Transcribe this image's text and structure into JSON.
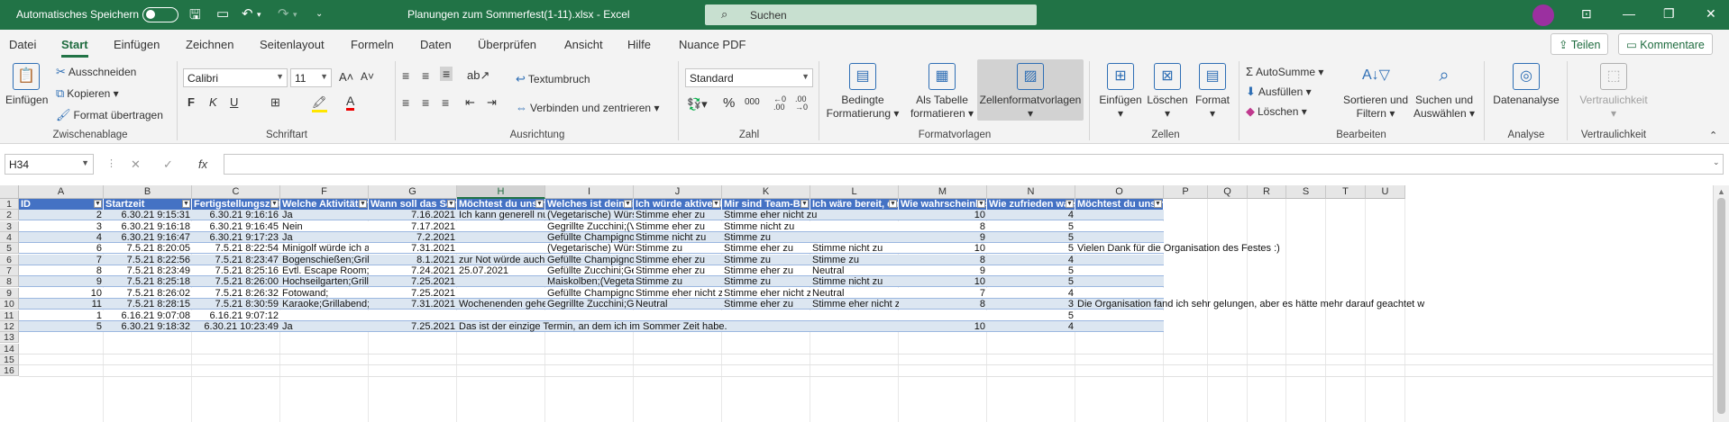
{
  "titlebar": {
    "autosave_label": "Automatisches Speichern",
    "doc_title": "Planungen zum Sommerfest(1-11).xlsx  -  Excel",
    "search_placeholder": "Suchen"
  },
  "tabs": [
    "Datei",
    "Start",
    "Einfügen",
    "Zeichnen",
    "Seitenlayout",
    "Formeln",
    "Daten",
    "Überprüfen",
    "Ansicht",
    "Hilfe",
    "Nuance PDF"
  ],
  "active_tab": "Start",
  "share_label": "Teilen",
  "comments_label": "Kommentare",
  "ribbon": {
    "clipboard": {
      "paste": "Einfügen",
      "cut": "Ausschneiden",
      "copy": "Kopieren",
      "format_painter": "Format übertragen",
      "group": "Zwischenablage"
    },
    "font": {
      "name": "Calibri",
      "size": "11",
      "bold": "F",
      "italic": "K",
      "underline": "U",
      "group": "Schriftart"
    },
    "alignment": {
      "wrap": "Textumbruch",
      "merge": "Verbinden und zentrieren",
      "group": "Ausrichtung"
    },
    "number": {
      "format": "Standard",
      "group": "Zahl"
    },
    "styles": {
      "conditional_1": "Bedingte",
      "conditional_2": "Formatierung",
      "table_1": "Als Tabelle",
      "table_2": "formatieren",
      "cell_styles": "Zellenformatvorlagen",
      "group": "Formatvorlagen"
    },
    "cells": {
      "insert": "Einfügen",
      "delete": "Löschen",
      "format": "Format",
      "group": "Zellen"
    },
    "editing": {
      "autosum": "AutoSumme",
      "fill": "Ausfüllen",
      "clear": "Löschen",
      "sort_1": "Sortieren und",
      "sort_2": "Filtern",
      "find_1": "Suchen und",
      "find_2": "Auswählen",
      "group": "Bearbeiten"
    },
    "analysis": {
      "label": "Datenanalyse",
      "group": "Analyse"
    },
    "sensitivity": {
      "label": "Vertraulichkeit",
      "group": "Vertraulichkeit"
    }
  },
  "formula_bar": {
    "name_box": "H34",
    "content": ""
  },
  "columns": [
    "A",
    "B",
    "C",
    "F",
    "G",
    "H",
    "I",
    "J",
    "K",
    "L",
    "M",
    "N",
    "O",
    "P",
    "Q",
    "R",
    "S",
    "T",
    "U"
  ],
  "selected_column": "H",
  "row_numbers": [
    "1",
    "2",
    "3",
    "4",
    "5",
    "6",
    "7",
    "8",
    "9",
    "10",
    "11",
    "12",
    "13",
    "14",
    "15",
    "16"
  ],
  "headers": [
    "ID",
    "Startzeit",
    "Fertigstellungszeit",
    "Welche Aktivitäten s",
    "Wann soll das Somm",
    "Möchtest du uns noc",
    "Welches ist dein lieb",
    "Ich würde aktive Unt",
    "Mir sind Team-Build",
    "Ich wäre bereit, eine",
    "Wie wahrscheinlich i",
    "Wie zufrieden warst",
    "Möchtest du uns noc"
  ],
  "rows": [
    [
      "2",
      "6.30.21 9:15:31",
      "6.30.21 9:16:16",
      "Ja",
      "7.16.2021",
      "Ich kann generell nur",
      "(Vegetarische) Würstc",
      "Stimme eher zu",
      "Stimme eher nicht zu",
      "",
      "10",
      "4",
      ""
    ],
    [
      "3",
      "6.30.21 9:16:18",
      "6.30.21 9:16:45",
      "Nein",
      "7.17.2021",
      "",
      "Gegrillte Zucchini;(Ve",
      "Stimme eher zu",
      "Stimme nicht zu",
      "",
      "8",
      "5",
      ""
    ],
    [
      "4",
      "6.30.21 9:16:47",
      "6.30.21 9:17:23",
      "Ja",
      "7.2.2021",
      "",
      "Gefüllte Champignon",
      "Stimme nicht zu",
      "Stimme zu",
      "",
      "9",
      "5",
      ""
    ],
    [
      "6",
      "7.5.21 8:20:05",
      "7.5.21 8:22:54",
      "Minigolf würde ich au",
      "7.31.2021",
      "",
      "(Vegetarische) Würstc",
      "Stimme zu",
      "Stimme eher zu",
      "Stimme nicht zu",
      "10",
      "5",
      "Vielen Dank für die Organisation des Festes :)"
    ],
    [
      "7",
      "7.5.21 8:22:56",
      "7.5.21 8:23:47",
      "Bogenschießen;Grilla",
      "8.1.2021",
      "zur Not würde auch 31",
      "Gefüllte Champignon",
      "Stimme eher zu",
      "Stimme zu",
      "Stimme zu",
      "8",
      "4",
      ""
    ],
    [
      "8",
      "7.5.21 8:23:49",
      "7.5.21 8:25:16",
      "Evtl. Escape Room;Kri",
      "7.24.2021",
      "25.07.2021",
      "Gefüllte Zucchini;Gef",
      "Stimme eher zu",
      "Stimme eher zu",
      "Neutral",
      "9",
      "5",
      ""
    ],
    [
      "9",
      "7.5.21 8:25:18",
      "7.5.21 8:26:00",
      "Hochseilgarten;Grilla",
      "7.25.2021",
      "",
      "Maiskolben;(Vegetari",
      "Stimme zu",
      "Stimme zu",
      "Stimme nicht zu",
      "10",
      "5",
      ""
    ],
    [
      "10",
      "7.5.21 8:26:02",
      "7.5.21 8:26:32",
      "Fotowand;",
      "7.25.2021",
      "",
      "Gefüllte Champignon",
      "Stimme eher nicht zu",
      "Stimme eher nicht zu",
      "Neutral",
      "7",
      "4",
      ""
    ],
    [
      "11",
      "7.5.21 8:28:15",
      "7.5.21 8:30:59",
      "Karaoke;Grillabend;Fo",
      "7.31.2021",
      "Wochenenden gehen",
      "Gegrillte Zucchini;Gef",
      "Neutral",
      "Stimme eher zu",
      "Stimme eher nicht zu",
      "8",
      "3",
      "Die Organisation fand ich sehr gelungen, aber es hätte mehr darauf geachtet w"
    ],
    [
      "1",
      "6.16.21 9:07:08",
      "6.16.21 9:07:12",
      "",
      "",
      "",
      "",
      "",
      "",
      "",
      "",
      "5",
      ""
    ],
    [
      "5",
      "6.30.21 9:18:32",
      "6.30.21 10:23:49",
      "Ja",
      "7.25.2021",
      "Das ist der einzige Termin, an dem ich im Sommer Zeit habe.",
      "",
      "",
      "",
      "",
      "10",
      "4",
      ""
    ]
  ],
  "colors": {
    "excel_green": "#217346",
    "table_header": "#4472c4",
    "band_light": "#dce6f1"
  }
}
